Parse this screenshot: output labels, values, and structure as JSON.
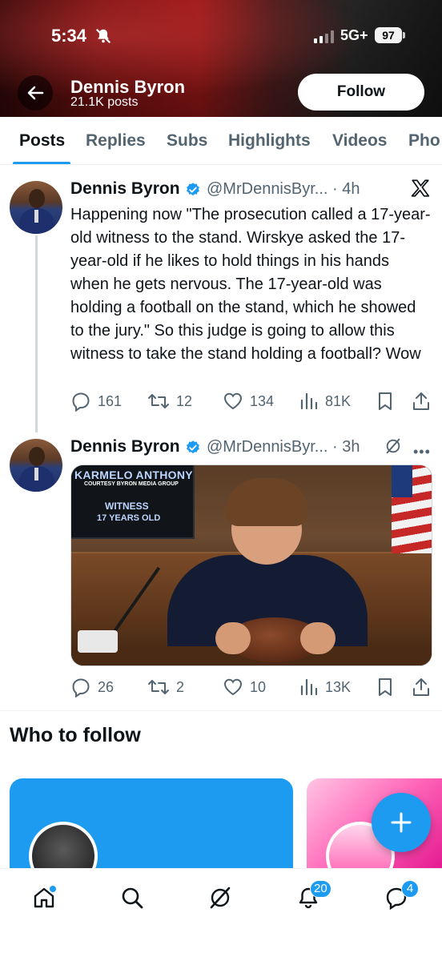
{
  "status_bar": {
    "time": "5:34",
    "network": "5G+",
    "battery": "97"
  },
  "header": {
    "name": "Dennis Byron",
    "post_count": "21.1K posts",
    "follow_label": "Follow"
  },
  "tabs": [
    {
      "label": "Posts",
      "active": true
    },
    {
      "label": "Replies"
    },
    {
      "label": "Subs"
    },
    {
      "label": "Highlights"
    },
    {
      "label": "Videos"
    },
    {
      "label": "Pho"
    }
  ],
  "posts": [
    {
      "author": "Dennis Byron",
      "handle": "@MrDennisByr... · 4h",
      "text": "Happening now \"The prosecution called a 17-year-old witness to the stand. Wirskye asked the 17-year-old if he likes to hold things in his hands when he gets nervous. The 17-year-old was holding a football on the stand, which he showed to the jury.\" So this judge is going to allow this witness to take the stand holding a football? Wow",
      "replies": "161",
      "reposts": "12",
      "likes": "134",
      "views": "81K"
    },
    {
      "author": "Dennis Byron",
      "handle": "@MrDennisByr... · 3h",
      "media_overlay": {
        "name": "KARMELO ANTHONY",
        "credit": "COURTESY BYRON MEDIA GROUP",
        "witness": "WITNESS",
        "age": "17 YEARS OLD"
      },
      "replies": "26",
      "reposts": "2",
      "likes": "10",
      "views": "13K"
    }
  ],
  "who_to_follow": {
    "title": "Who to follow"
  },
  "bottom_nav": {
    "notifications_badge": "20",
    "messages_badge": "4"
  },
  "colors": {
    "accent": "#1d9bf0",
    "text": "#0f1419",
    "muted": "#536471"
  }
}
